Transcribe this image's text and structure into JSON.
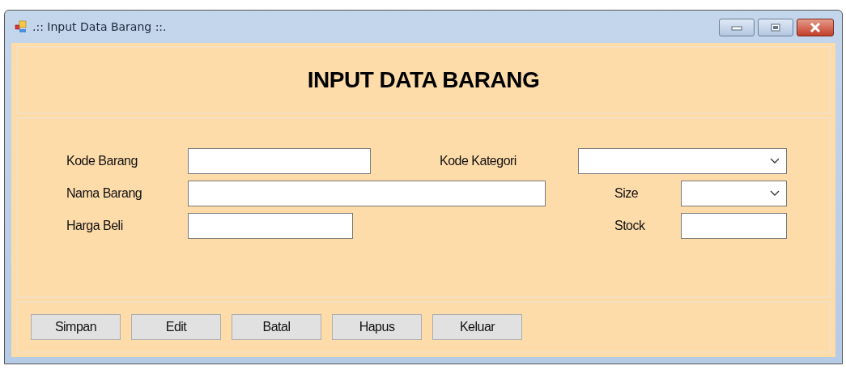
{
  "window": {
    "title": ".:: Input Data Barang ::."
  },
  "heading": "INPUT DATA BARANG",
  "rows": [
    {
      "left": {
        "label": "Kode Barang"
      },
      "right": {
        "label": "Kode Kategori",
        "kind": "combo"
      }
    },
    {
      "left": {
        "label": "Nama Barang"
      },
      "right": {
        "label": "Size",
        "kind": "combo"
      }
    },
    {
      "left": {
        "label": "Harga Beli"
      },
      "right": {
        "label": "Stock",
        "kind": "text"
      }
    }
  ],
  "buttons": [
    "Simpan",
    "Edit",
    "Batal",
    "Hapus",
    "Keluar"
  ]
}
